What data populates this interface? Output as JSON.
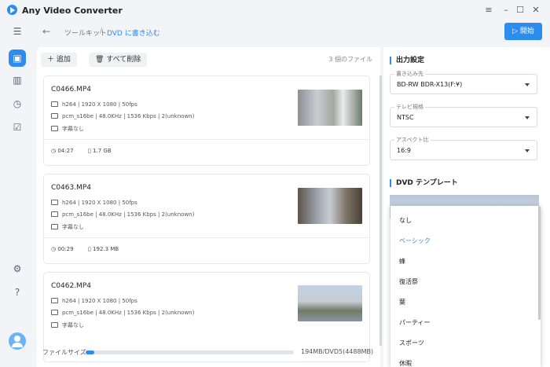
{
  "app": {
    "title": "Any Video Converter"
  },
  "window_controls": {
    "menu": "≡",
    "minimize": "–",
    "maximize": "☐",
    "close": "✕"
  },
  "breadcrumb": {
    "back": "←",
    "parent": "ツールキット",
    "separator": "/",
    "current": "DVD に書き込む"
  },
  "start_button": {
    "label": "開始"
  },
  "sidebar": {
    "icons": [
      "menu-icon",
      "toolbox-icon",
      "library-icon",
      "history-icon",
      "task-icon",
      "settings-icon",
      "help-icon",
      "avatar-icon"
    ]
  },
  "toolbar": {
    "add_label": "追加",
    "delete_all_label": "すべて削除",
    "file_count": "3 個のファイル"
  },
  "files": [
    {
      "name": "C0466.MP4",
      "video": "h264 | 1920 X 1080 | 50fps",
      "audio": "pcm_s16be | 48.0KHz | 1536 Kbps | 2(unknown)",
      "subtitle": "字幕なし",
      "duration": "04:27",
      "size": "1.7 GB"
    },
    {
      "name": "C0463.MP4",
      "video": "h264 | 1920 X 1080 | 50fps",
      "audio": "pcm_s16be | 48.0KHz | 1536 Kbps | 2(unknown)",
      "subtitle": "字幕なし",
      "duration": "00:29",
      "size": "192.3 MB"
    },
    {
      "name": "C0462.MP4",
      "video": "h264 | 1920 X 1080 | 50fps",
      "audio": "pcm_s16be | 48.0KHz | 1536 Kbps | 2(unknown)",
      "subtitle": "字幕なし",
      "duration": "",
      "size": ""
    }
  ],
  "file_size": {
    "label": "ファイルサイズ:",
    "value": "194MB/DVD5(4488MB)",
    "fill_fraction": 0.04
  },
  "output_settings": {
    "title": "出力設定",
    "destination": {
      "label": "書き込み先",
      "value": "BD-RW BDR-X13(F:¥)"
    },
    "tv_standard": {
      "label": "テレビ規格",
      "value": "NTSC"
    },
    "aspect_ratio": {
      "label": "アスペクト比",
      "value": "16:9"
    }
  },
  "dvd_template": {
    "title": "DVD テンプレート",
    "options": [
      "なし",
      "ベーシック",
      "蜂",
      "復活祭",
      "葉",
      "パーティー",
      "スポーツ",
      "休暇"
    ],
    "selected": "ベーシック"
  },
  "colors": {
    "accent": "#2d8cf0",
    "background": "#f3f4f8"
  }
}
